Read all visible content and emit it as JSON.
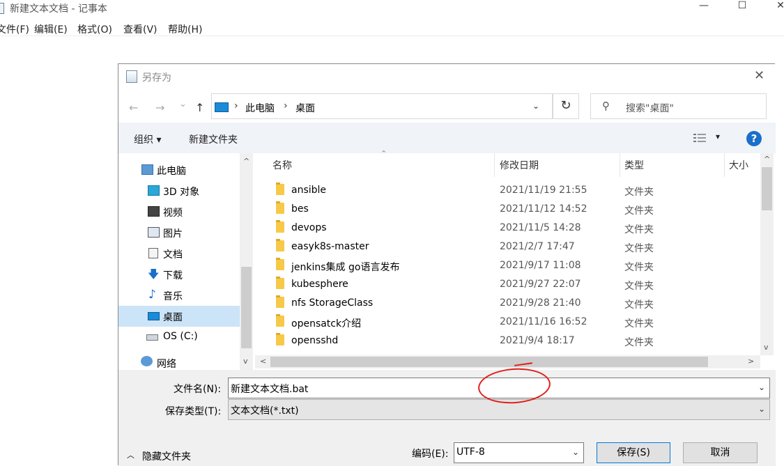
{
  "notepad": {
    "title": "新建文本文档 - 记事本",
    "menus": [
      "文件(F)",
      "编辑(E)",
      "格式(O)",
      "查看(V)",
      "帮助(H)"
    ],
    "controls": {
      "minimize": "—",
      "maximize": "☐",
      "close": "✕"
    }
  },
  "dialog": {
    "title": "另存为",
    "close": "✕",
    "nav": {
      "back": "←",
      "forward": "→",
      "recent": "⌄",
      "up": "↑"
    },
    "address": {
      "crumbs": [
        "此电脑",
        "桌面"
      ],
      "separator": "›",
      "dropdown": "⌄"
    },
    "refresh": "↻",
    "search_placeholder": "搜索\"桌面\"",
    "search_icon": "⚲",
    "toolbar": {
      "organize": "组织 ▾",
      "new_folder": "新建文件夹",
      "help": "?",
      "view_dropdown": "▾"
    },
    "sidebar": [
      {
        "label": "此电脑",
        "icon": "computer-icon"
      },
      {
        "label": "3D 对象",
        "icon": "cube-icon"
      },
      {
        "label": "视频",
        "icon": "video-icon"
      },
      {
        "label": "图片",
        "icon": "picture-icon"
      },
      {
        "label": "文档",
        "icon": "document-icon"
      },
      {
        "label": "下载",
        "icon": "download-icon"
      },
      {
        "label": "音乐",
        "icon": "music-icon"
      },
      {
        "label": "桌面",
        "icon": "desktop-icon",
        "selected": true
      },
      {
        "label": "OS (C:)",
        "icon": "drive-icon"
      },
      {
        "label": "网络",
        "icon": "network-icon"
      }
    ],
    "columns": {
      "name": "名称",
      "date": "修改日期",
      "type": "类型",
      "size": "大小"
    },
    "files": [
      {
        "name": "ansible",
        "date": "2021/11/19 21:55",
        "type": "文件夹"
      },
      {
        "name": "bes",
        "date": "2021/11/12 14:52",
        "type": "文件夹"
      },
      {
        "name": "devops",
        "date": "2021/11/5 14:28",
        "type": "文件夹"
      },
      {
        "name": "easyk8s-master",
        "date": "2021/2/7 17:47",
        "type": "文件夹"
      },
      {
        "name": "jenkins集成 go语言发布",
        "date": "2021/9/17 11:08",
        "type": "文件夹"
      },
      {
        "name": "kubesphere",
        "date": "2021/9/27 22:07",
        "type": "文件夹"
      },
      {
        "name": "nfs StorageClass",
        "date": "2021/9/28 21:40",
        "type": "文件夹"
      },
      {
        "name": "opensatck介绍",
        "date": "2021/11/16 16:52",
        "type": "文件夹"
      },
      {
        "name": "opensshd",
        "date": "2021/9/4 18:17",
        "type": "文件夹"
      }
    ],
    "filename_label": "文件名(N):",
    "filename_value": "新建文本文档.bat",
    "filetype_label": "保存类型(T):",
    "filetype_value": "文本文档(*.txt)",
    "hide_folders": "隐藏文件夹",
    "encoding_label": "编码(E):",
    "encoding_value": "UTF-8",
    "save_button": "保存(S)",
    "cancel_button": "取消",
    "scroll": {
      "up": "^",
      "down": "v",
      "left": "<",
      "right": ">"
    }
  },
  "colors": {
    "selection": "#cce4f7",
    "toolbar_bg": "#f0f3f8",
    "annotation": "#e0201c",
    "help": "#1a6fc9"
  }
}
